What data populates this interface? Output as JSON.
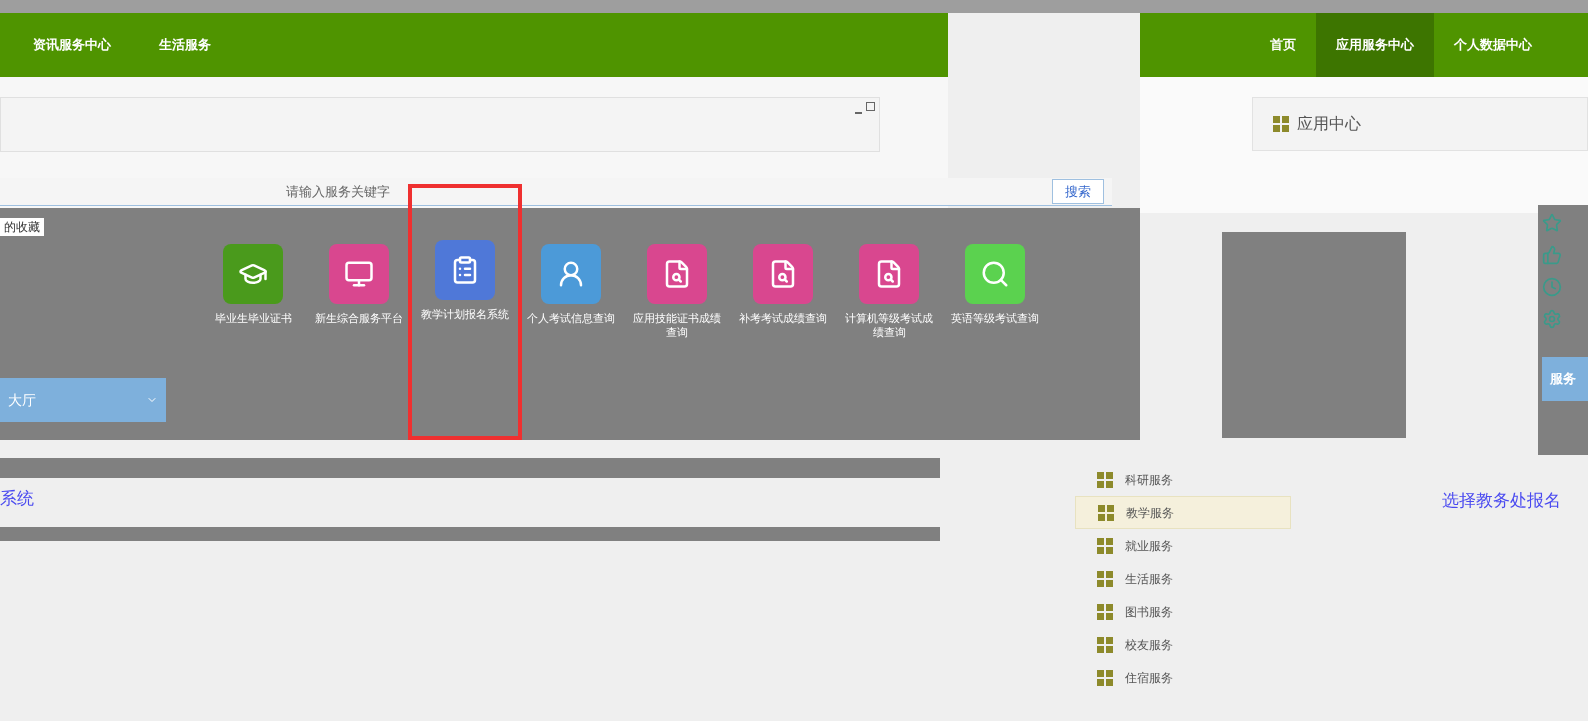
{
  "left_window": {
    "nav": [
      {
        "label": "资讯服务中心"
      },
      {
        "label": "生活服务"
      }
    ]
  },
  "search": {
    "placeholder": "请输入服务关键字",
    "button": "搜索"
  },
  "sidebar": {
    "items": [
      {
        "label": "的收藏"
      }
    ],
    "hall": "大厅"
  },
  "apps": [
    {
      "label": "毕业生毕业证书",
      "color": "#4a9a1c",
      "selected": false
    },
    {
      "label": "新生综合服务平台",
      "color": "#d9478f",
      "selected": false
    },
    {
      "label": "教学计划报名系统",
      "color": "#4f78d8",
      "selected": true
    },
    {
      "label": "个人考试信息查询",
      "color": "#4c9ad8",
      "selected": false
    },
    {
      "label": "应用技能证书成绩查询",
      "color": "#d9478f",
      "selected": false
    },
    {
      "label": "补考考试成绩查询",
      "color": "#d9478f",
      "selected": false
    },
    {
      "label": "计算机等级考试成绩查询",
      "color": "#d9478f",
      "selected": false
    },
    {
      "label": "英语等级考试查询",
      "color": "#5bd24f",
      "selected": false
    }
  ],
  "system_link": "系统",
  "right_window": {
    "nav": [
      {
        "label": "首页",
        "selected": false
      },
      {
        "label": "应用服务中心",
        "selected": true
      },
      {
        "label": "个人数据中心",
        "selected": false
      }
    ],
    "panel_title": "应用中心",
    "side_tab": "服务"
  },
  "categories": [
    {
      "label": "科研服务",
      "selected": false
    },
    {
      "label": "教学服务",
      "selected": true
    },
    {
      "label": "就业服务",
      "selected": false
    },
    {
      "label": "生活服务",
      "selected": false
    },
    {
      "label": "图书服务",
      "selected": false
    },
    {
      "label": "校友服务",
      "selected": false
    },
    {
      "label": "住宿服务",
      "selected": false
    }
  ],
  "enroll_link": "选择教务处报名"
}
